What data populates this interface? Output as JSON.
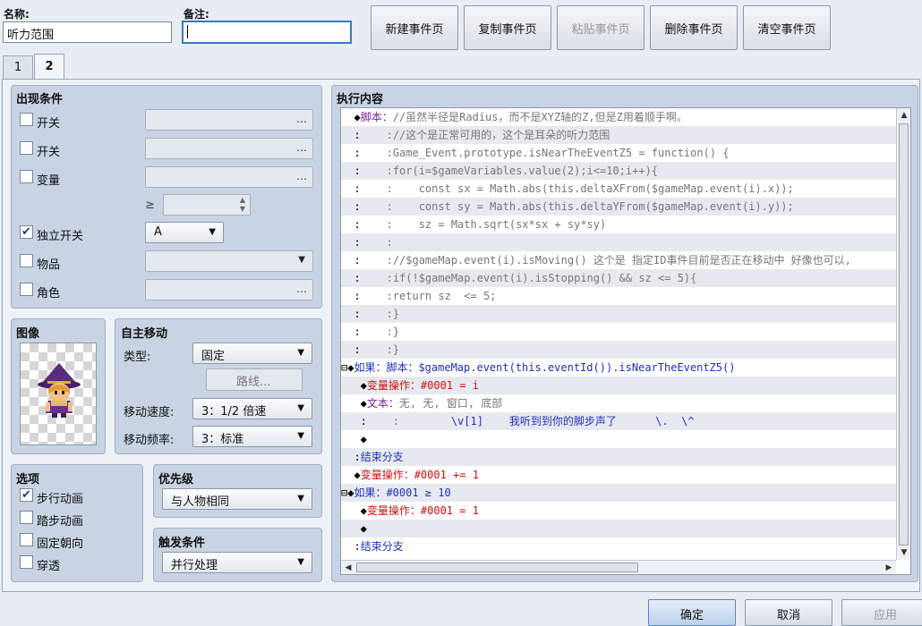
{
  "header": {
    "name_label": "名称:",
    "name_value": "听力范围",
    "note_label": "备注:",
    "note_value": ""
  },
  "toolbar": {
    "new_page": "新建事件页",
    "copy_page": "复制事件页",
    "paste_page": "粘贴事件页",
    "delete_page": "删除事件页",
    "clear_page": "清空事件页"
  },
  "tabs": [
    "1",
    "2"
  ],
  "conditions": {
    "title": "出现条件",
    "switch1_label": "开关",
    "switch2_label": "开关",
    "variable_label": "变量",
    "gte_symbol": "≥",
    "self_switch_label": "独立开关",
    "self_switch_value": "A",
    "item_label": "物品",
    "actor_label": "角色",
    "dots": "…"
  },
  "image": {
    "title": "图像"
  },
  "autonomous": {
    "title": "自主移动",
    "type_label": "类型:",
    "type_value": "固定",
    "route_button": "路线...",
    "speed_label": "移动速度:",
    "speed_value": "3：1/2 倍速",
    "freq_label": "移动频率:",
    "freq_value": "3：标准"
  },
  "options": {
    "title": "选项",
    "walking": "步行动画",
    "stepping": "踏步动画",
    "direction_fix": "固定朝向",
    "through": "穿透"
  },
  "priority": {
    "title": "优先级",
    "value": "与人物相同"
  },
  "trigger": {
    "title": "触发条件",
    "value": "并行处理"
  },
  "content": {
    "title": "执行内容",
    "rows": [
      {
        "prefix": "  ◆",
        "parts": [
          [
            "pur",
            "脚本："
          ],
          [
            "g",
            "//虽然半径是Radius，而不是XYZ轴的Z,但是Z用着顺手啊。"
          ]
        ]
      },
      {
        "prefix": "  :    ",
        "parts": [
          [
            "g",
            ":"
          ],
          [
            "g",
            "//这个是正常可用的，这个是耳朵的听力范围"
          ]
        ]
      },
      {
        "prefix": "  :    ",
        "parts": [
          [
            "g",
            ":"
          ],
          [
            "g",
            "Game_Event.prototype.isNearTheEventZ5 = function() {"
          ]
        ]
      },
      {
        "prefix": "  :    ",
        "parts": [
          [
            "g",
            ":"
          ],
          [
            "g",
            "for(i=$gameVariables.value(2);i<=10;i++){"
          ]
        ]
      },
      {
        "prefix": "  :    ",
        "parts": [
          [
            "g",
            ":"
          ],
          [
            "g",
            "    const sx = Math.abs(this.deltaXFrom($gameMap.event(i).x));"
          ]
        ]
      },
      {
        "prefix": "  :    ",
        "parts": [
          [
            "g",
            ":"
          ],
          [
            "g",
            "    const sy = Math.abs(this.deltaYFrom($gameMap.event(i).y));"
          ]
        ]
      },
      {
        "prefix": "  :    ",
        "parts": [
          [
            "g",
            ":"
          ],
          [
            "g",
            "    sz = Math.sqrt(sx*sx + sy*sy)"
          ]
        ]
      },
      {
        "prefix": "  :    ",
        "parts": [
          [
            "g",
            ":"
          ],
          [
            "g",
            ""
          ]
        ]
      },
      {
        "prefix": "  :    ",
        "parts": [
          [
            "g",
            ":"
          ],
          [
            "g",
            "//$gameMap.event(i).isMoving() 这个是 指定ID事件目前是否正在移动中 好像也可以,"
          ]
        ]
      },
      {
        "prefix": "  :    ",
        "parts": [
          [
            "g",
            ":"
          ],
          [
            "g",
            "if(!$gameMap.event(i).isStopping() && sz <= 5){"
          ]
        ]
      },
      {
        "prefix": "  :    ",
        "parts": [
          [
            "g",
            ":"
          ],
          [
            "g",
            "return sz  <= 5;"
          ]
        ]
      },
      {
        "prefix": "  :    ",
        "parts": [
          [
            "g",
            ":"
          ],
          [
            "g",
            "}"
          ]
        ]
      },
      {
        "prefix": "  :    ",
        "parts": [
          [
            "g",
            ":"
          ],
          [
            "g",
            "}"
          ]
        ]
      },
      {
        "prefix": "  :    ",
        "parts": [
          [
            "g",
            ":"
          ],
          [
            "g",
            "}"
          ]
        ]
      },
      {
        "prefix": "⊟◆",
        "parts": [
          [
            "blu",
            "如果：脚本：$gameMap.event(this.eventId()).isNearTheEventZ5()"
          ]
        ]
      },
      {
        "prefix": "   ◆",
        "parts": [
          [
            "red",
            "变量操作：#0001 = i"
          ]
        ]
      },
      {
        "prefix": "   ◆",
        "parts": [
          [
            "pur",
            "文本："
          ],
          [
            "g",
            "无, 无, 窗口, 底部"
          ]
        ]
      },
      {
        "prefix": "   :    ",
        "parts": [
          [
            "g",
            ":"
          ],
          [
            "blu",
            "        \\v[1]    我听到到你的脚步声了      \\.  \\^"
          ]
        ]
      },
      {
        "prefix": "   ◆",
        "parts": []
      },
      {
        "prefix": "  :",
        "parts": [
          [
            "blu",
            "结束分支"
          ]
        ]
      },
      {
        "prefix": "  ◆",
        "parts": [
          [
            "red",
            "变量操作：#0001 += 1"
          ]
        ]
      },
      {
        "prefix": "⊟◆",
        "parts": [
          [
            "blu",
            "如果：#0001 ≥ 10"
          ]
        ]
      },
      {
        "prefix": "   ◆",
        "parts": [
          [
            "red",
            "变量操作：#0001 = 1"
          ]
        ]
      },
      {
        "prefix": "   ◆",
        "parts": []
      },
      {
        "prefix": "  :",
        "parts": [
          [
            "blu",
            "结束分支"
          ]
        ]
      }
    ]
  },
  "footer": {
    "ok": "确定",
    "cancel": "取消",
    "apply": "应用"
  }
}
